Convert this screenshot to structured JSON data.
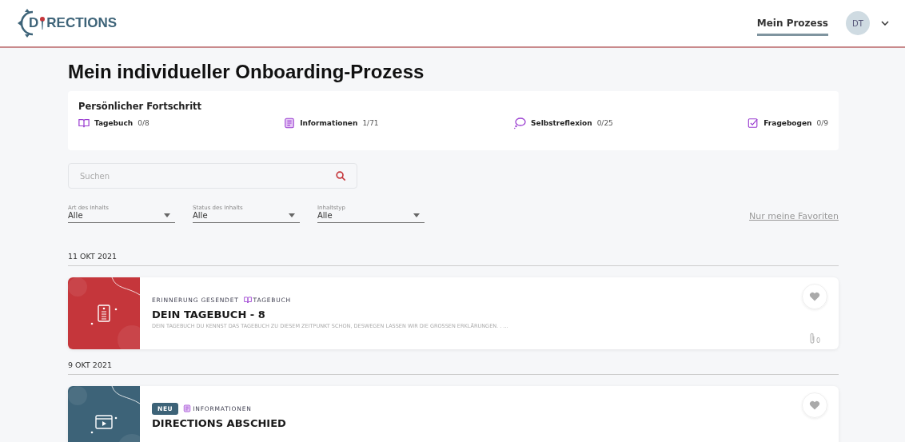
{
  "header": {
    "logo": {
      "before": "D",
      "after": "RECTIONS"
    },
    "nav": [
      {
        "label": "Mein Prozess",
        "selected": true
      }
    ],
    "avatar": "DT"
  },
  "title": "Mein individueller Onboarding-Prozess",
  "progress": {
    "title": "Persönlicher Fortschritt",
    "items": [
      {
        "kind": "book",
        "label": "Tagebuch",
        "count": "0/8"
      },
      {
        "kind": "doc",
        "label": "Informationen",
        "count": "1/71"
      },
      {
        "kind": "bubble",
        "label": "Selbstreflexion",
        "count": "0/25"
      },
      {
        "kind": "check",
        "label": "Fragebogen",
        "count": "0/9"
      }
    ]
  },
  "search": {
    "placeholder": "Suchen"
  },
  "filters": [
    {
      "label": "Art des Inhalts",
      "value": "Alle"
    },
    {
      "label": "Status des Inhalts",
      "value": "Alle"
    },
    {
      "label": "Inhaltstyp",
      "value": "Alle"
    }
  ],
  "favorites_link": "Nur meine Favoriten",
  "groups": [
    {
      "date": "11 OKT 2021",
      "cards": [
        {
          "color": "#c5363b",
          "kind": "doc",
          "status": {
            "kind": "text",
            "label": "ERINNERUNG GESENDET"
          },
          "category": {
            "kind": "book",
            "label": "TAGEBUCH"
          },
          "title": "DEIN TAGEBUCH - 8",
          "description": "DEIN TAGEBUCH DU KENNST DAS TAGEBUCH ZU DIESEM ZEITPUNKT SCHON, DESWEGEN LASSEN WIR DIE GROSSEN ERKLÄRUNGEN. . ...",
          "favorite": false,
          "attachments": "0"
        }
      ]
    },
    {
      "date": "9 OKT 2021",
      "cards": [
        {
          "color": "#3d6378",
          "kind": "video",
          "status": {
            "kind": "badge",
            "label": "NEU"
          },
          "category": {
            "kind": "doc",
            "label": "INFORMATIONEN"
          },
          "title": "DIRECTIONS ABSCHIED",
          "favorite": false
        }
      ]
    }
  ]
}
